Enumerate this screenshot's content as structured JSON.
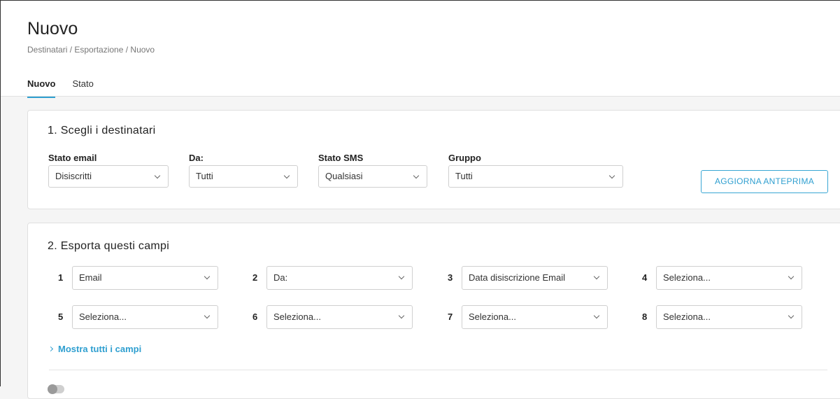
{
  "header": {
    "title": "Nuovo",
    "breadcrumb": "Destinatari / Esportazione / Nuovo",
    "tabs": [
      {
        "label": "Nuovo",
        "active": true
      },
      {
        "label": "Stato",
        "active": false
      }
    ]
  },
  "recipients": {
    "title": "1. Scegli i destinatari",
    "filters": [
      {
        "label": "Stato email",
        "value": "Disiscritti"
      },
      {
        "label": "Da:",
        "value": "Tutti"
      },
      {
        "label": "Stato SMS",
        "value": "Qualsiasi"
      },
      {
        "label": "Gruppo",
        "value": "Tutti"
      }
    ],
    "refresh_button": "AGGIORNA ANTEPRIMA"
  },
  "export": {
    "title": "2. Esporta questi campi",
    "fields": [
      {
        "num": "1",
        "value": "Email"
      },
      {
        "num": "2",
        "value": "Da:"
      },
      {
        "num": "3",
        "value": "Data disiscrizione Email"
      },
      {
        "num": "4",
        "value": "Seleziona..."
      },
      {
        "num": "5",
        "value": "Seleziona..."
      },
      {
        "num": "6",
        "value": "Seleziona..."
      },
      {
        "num": "7",
        "value": "Seleziona..."
      },
      {
        "num": "8",
        "value": "Seleziona..."
      }
    ],
    "show_all": "Mostra tutti i campi"
  },
  "colors": {
    "accent": "#2f9fd0",
    "background": "#f5f5f5",
    "card": "#ffffff"
  },
  "icons": [
    "chevron-down-icon",
    "chevron-right-icon",
    "toggle-switch"
  ]
}
